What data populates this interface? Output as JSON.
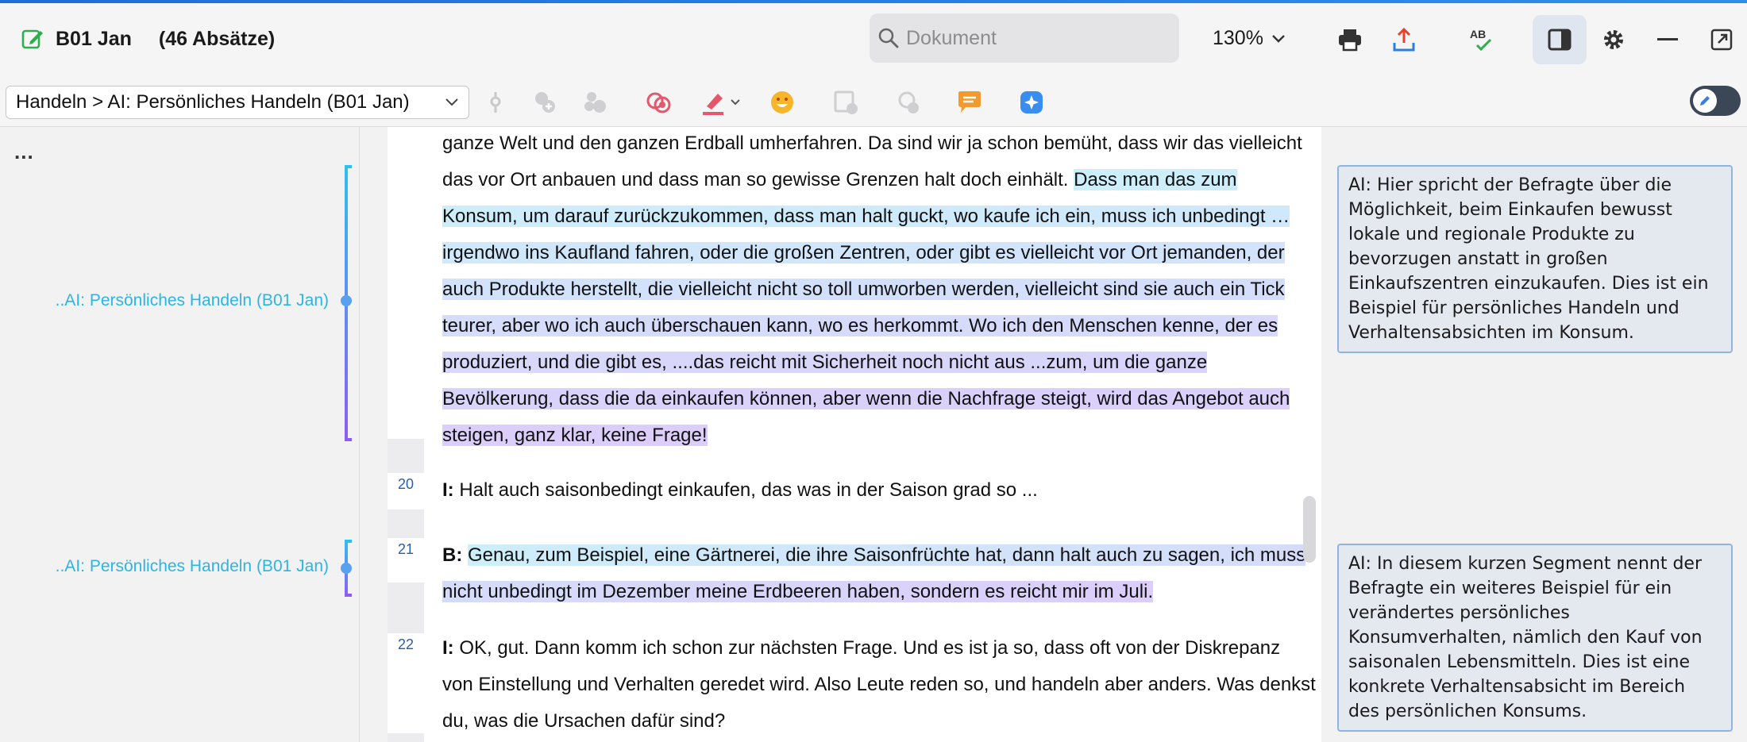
{
  "header": {
    "doc_name": "B01 Jan",
    "paragraph_count": "(46 Absätze)",
    "search_placeholder": "Dokument",
    "zoom": "130%"
  },
  "toolbar": {
    "code_selector": "Handeln > AI: Persönliches Handeln (B01 Jan)"
  },
  "left": {
    "more": "...",
    "code_labels": [
      "..AI: Persönliches Handeln (B01 Jan)",
      "..AI: Persönliches Handeln (B01 Jan)"
    ]
  },
  "document": {
    "para19_plain": "ganze Welt und den ganzen Erdball umherfahren. Da sind wir ja schon bemüht, dass wir das vielleicht das vor Ort anbauen und dass man so gewisse Grenzen halt doch einhält. ",
    "para19_coded": "Dass man das zum Konsum, um darauf zurückzukommen, dass man halt guckt, wo kaufe ich ein, muss ich unbedingt … irgendwo ins Kaufland fahren, oder die großen Zentren, oder gibt es vielleicht vor Ort jemanden, der auch Produkte herstellt, die vielleicht nicht so toll umworben werden, vielleicht sind sie auch ein Tick teurer, aber wo ich auch überschauen kann, wo es herkommt. Wo ich den Menschen kenne, der es produziert, und die gibt es, ....das reicht mit Sicherheit noch nicht aus ...zum, um die ganze Bevölkerung, dass die da einkaufen können, aber wenn die Nachfrage steigt, wird das Angebot auch steigen, ganz klar, keine Frage!",
    "para20_num": "20",
    "para20_speaker": "I:",
    "para20_text": " Halt auch saisonbedingt einkaufen, das was in der Saison grad so ...",
    "para21_num": "21",
    "para21_speaker": "B:",
    "para21_coded": "Genau, zum Beispiel, eine Gärtnerei, die ihre Saisonfrüchte hat, dann halt auch zu sagen, ich muss nicht unbedingt im Dezember meine Erdbeeren haben, sondern es reicht mir im Juli.",
    "para22_num": "22",
    "para22_speaker": "I:",
    "para22_text": " OK, gut. Dann komm ich schon zur nächsten Frage. Und es ist ja so, dass oft von der Diskrepanz von Einstellung und Verhalten geredet wird. Also Leute reden so, und handeln aber anders. Was denkst du, was die Ursachen dafür sind?"
  },
  "memos": [
    "AI: Hier spricht der Befragte über die Möglichkeit, beim Einkaufen bewusst lokale und regionale Produkte zu bevorzugen anstatt in großen Einkaufszentren einzukaufen. Dies ist ein Beispiel für persönliches Handeln und Verhaltensabsichten im Konsum.",
    "AI: In diesem kurzen Segment nennt der Befragte ein weiteres Beispiel für ein verändertes persönliches Konsumverhalten, nämlich den Kauf von saisonalen Lebensmitteln. Dies ist eine konkrete Verhaltensabsicht im Bereich des persönlichen Konsums."
  ],
  "colors": {
    "accent": "#2f8fe8",
    "code_color": "#29b6e4",
    "memo_border": "#8fb4e3"
  }
}
